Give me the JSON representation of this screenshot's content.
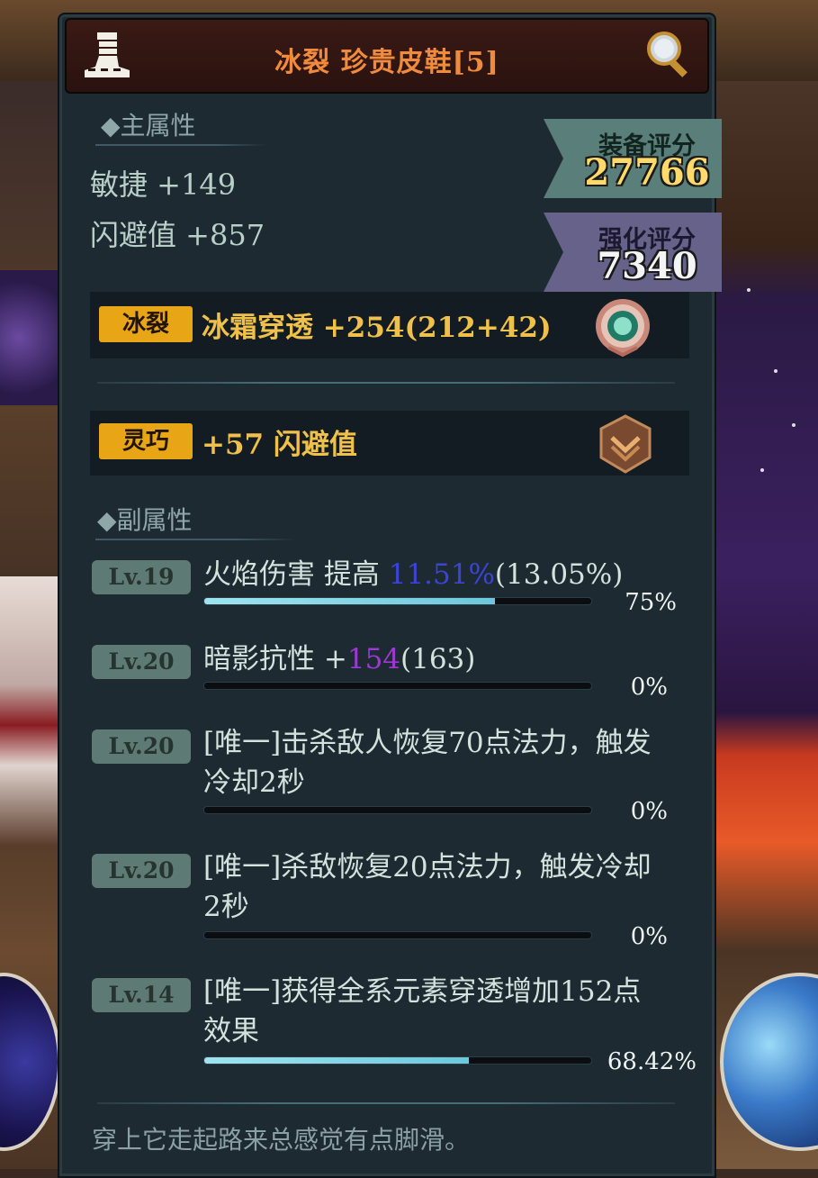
{
  "header": {
    "title": "冰裂 珍贵皮鞋[5]",
    "icons": {
      "left": "boot-armor-icon",
      "right": "magnifier-icon"
    }
  },
  "main_section": {
    "label": "◆主属性",
    "stats": [
      "敏捷 +149",
      "闪避值 +857"
    ]
  },
  "scores": {
    "equip_label": "装备评分",
    "equip_value": "27766",
    "enhance_label": "强化评分",
    "enhance_value": "7340"
  },
  "slots": [
    {
      "tag": "冰裂",
      "text": "冰霜穿透 +254(212+42)",
      "icon": "frost-emblem-icon"
    },
    {
      "tag": "灵巧",
      "text": "+57 闪避值",
      "icon": "bronze-rank-shield-icon"
    }
  ],
  "sub_section": {
    "label": "◆副属性",
    "attributes": [
      {
        "level": "Lv.19",
        "prefix": "火焰伤害 提高 ",
        "highlight": "11.51%",
        "suffix": "(13.05%)",
        "progress_label": "75%",
        "progress": 0.75
      },
      {
        "level": "Lv.20",
        "prefix": "暗影抗性 +",
        "highlight": "154",
        "suffix": "(163)",
        "progress_label": "0%",
        "progress": 0
      },
      {
        "level": "Lv.20",
        "line1": "[唯一]击杀敌人恢复70点法力，触发",
        "line2": "冷却2秒",
        "progress_label": "0%",
        "progress": 0
      },
      {
        "level": "Lv.20",
        "line1": "[唯一]杀敌恢复20点法力，触发冷却",
        "line2": "2秒",
        "progress_label": "0%",
        "progress": 0
      },
      {
        "level": "Lv.14",
        "line1": "[唯一]获得全系元素穿透增加152点",
        "line2": "效果",
        "progress_label": "68.42%",
        "progress": 0.6842
      }
    ]
  },
  "flavor_text": "穿上它走起路来总感觉有点脚滑。"
}
